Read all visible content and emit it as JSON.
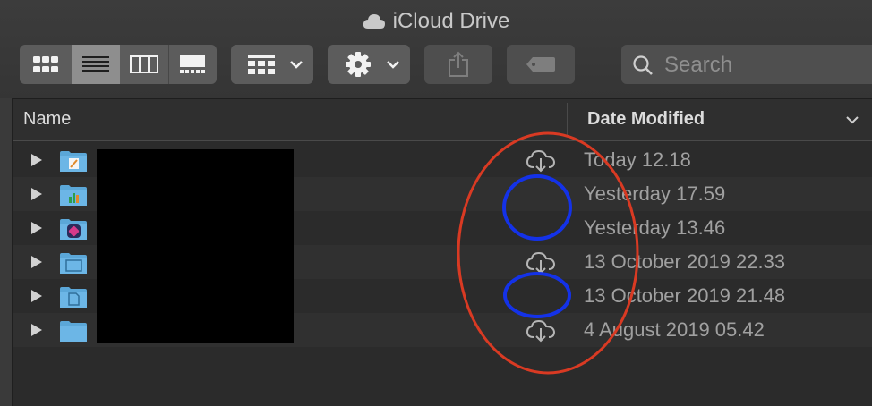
{
  "window": {
    "title": "iCloud Drive"
  },
  "toolbar": {
    "view_icons": [
      "icon-view-icon",
      "list-view-icon",
      "column-view-icon",
      "gallery-view-icon"
    ],
    "selected_view": "list",
    "group_icon": "group-by-icon",
    "action_icon": "gear-icon",
    "share_icon": "share-icon",
    "tag_icon": "tag-icon"
  },
  "search": {
    "placeholder": "Search"
  },
  "columns": {
    "name": "Name",
    "date_modified": "Date Modified"
  },
  "rows": [
    {
      "date": "Today 12.18",
      "cloud_download": true,
      "folder_badge": "pages"
    },
    {
      "date": "Yesterday 17.59",
      "cloud_download": false,
      "folder_badge": "numbers"
    },
    {
      "date": "Yesterday 13.46",
      "cloud_download": false,
      "folder_badge": "shortcuts"
    },
    {
      "date": "13 October 2019 22.33",
      "cloud_download": true,
      "folder_badge": "preview"
    },
    {
      "date": "13 October 2019 21.48",
      "cloud_download": false,
      "folder_badge": "textedit"
    },
    {
      "date": "4 August 2019 05.42",
      "cloud_download": true,
      "folder_badge": "none"
    }
  ],
  "colors": {
    "annotation_red": "#d93a23",
    "annotation_blue": "#1432e8",
    "folder_blue": "#5ba7d8"
  }
}
